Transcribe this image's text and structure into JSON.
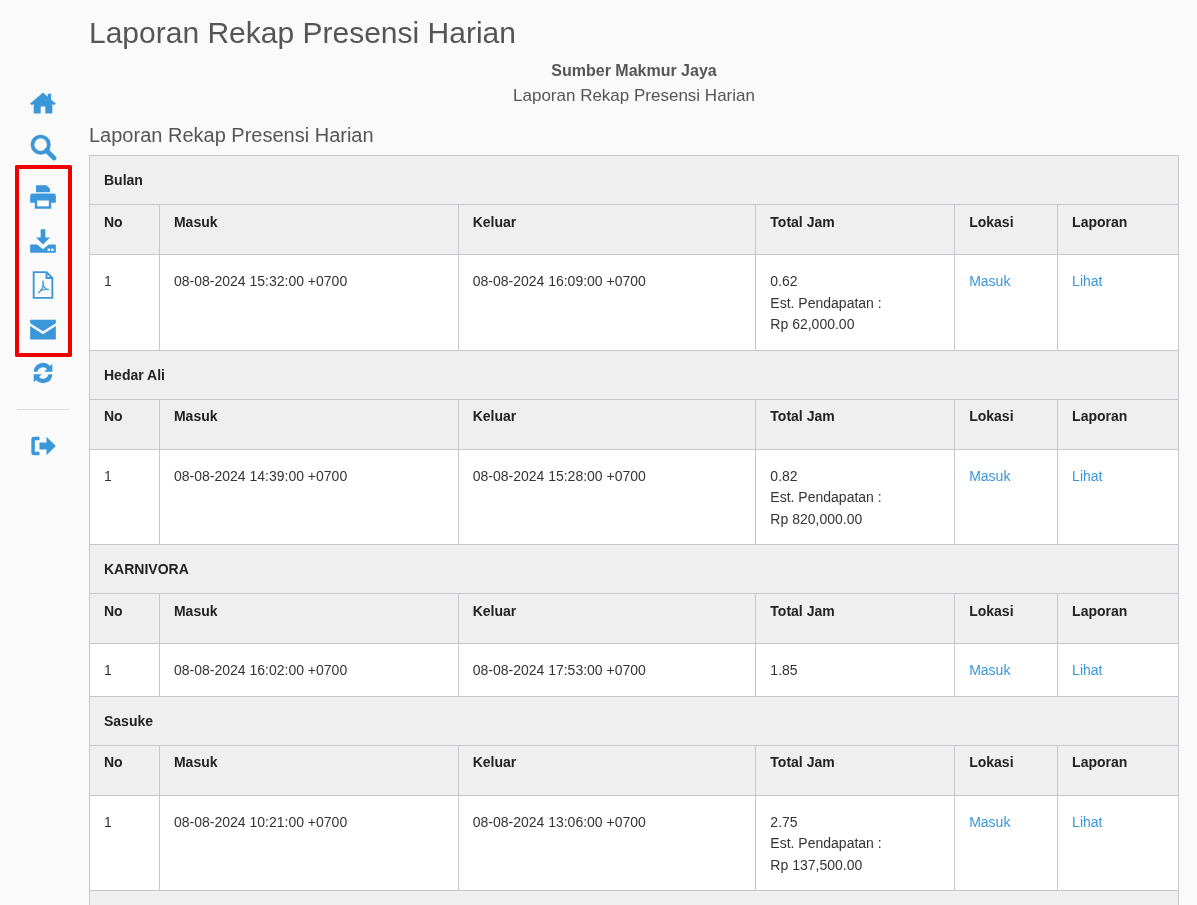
{
  "page_title": "Laporan Rekap Presensi Harian",
  "company": "Sumber Makmur Jaya",
  "subtitle": "Laporan Rekap Presensi Harian",
  "section_title": "Laporan Rekap Presensi Harian",
  "sidebar": {
    "items": [
      {
        "kind": "home",
        "highlighted": false
      },
      {
        "kind": "search",
        "highlighted": false
      },
      {
        "kind": "print",
        "highlighted": true
      },
      {
        "kind": "download",
        "highlighted": true
      },
      {
        "kind": "pdf",
        "highlighted": true
      },
      {
        "kind": "email",
        "highlighted": true
      },
      {
        "kind": "refresh",
        "highlighted": false
      },
      {
        "kind": "logout",
        "highlighted": false
      }
    ]
  },
  "groups": [
    {
      "name": "Bulan",
      "columns": [
        "No",
        "Masuk",
        "Keluar",
        "Total Jam",
        "Lokasi",
        "Laporan"
      ],
      "rows": [
        {
          "no": "1",
          "masuk": "08-08-2024 15:32:00 +0700",
          "keluar": "08-08-2024 16:09:00 +0700",
          "total_jam": [
            "0.62",
            "Est. Pendapatan :",
            "Rp 62,000.00"
          ],
          "lokasi": "Masuk",
          "laporan": "Lihat"
        }
      ]
    },
    {
      "name": "Hedar Ali",
      "columns": [
        "No",
        "Masuk",
        "Keluar",
        "Total Jam",
        "Lokasi",
        "Laporan"
      ],
      "rows": [
        {
          "no": "1",
          "masuk": "08-08-2024 14:39:00 +0700",
          "keluar": "08-08-2024 15:28:00 +0700",
          "total_jam": [
            "0.82",
            "Est. Pendapatan :",
            "Rp 820,000.00"
          ],
          "lokasi": "Masuk",
          "laporan": "Lihat"
        }
      ]
    },
    {
      "name": "KARNIVORA",
      "columns": [
        "No",
        "Masuk",
        "Keluar",
        "Total Jam",
        "Lokasi",
        "Laporan"
      ],
      "rows": [
        {
          "no": "1",
          "masuk": "08-08-2024 16:02:00 +0700",
          "keluar": "08-08-2024 17:53:00 +0700",
          "total_jam": [
            "1.85"
          ],
          "lokasi": "Masuk",
          "laporan": "Lihat"
        }
      ]
    },
    {
      "name": "Sasuke",
      "columns": [
        "No",
        "Masuk",
        "Keluar",
        "Total Jam",
        "Lokasi",
        "Laporan"
      ],
      "rows": [
        {
          "no": "1",
          "masuk": "08-08-2024 10:21:00 +0700",
          "keluar": "08-08-2024 13:06:00 +0700",
          "total_jam": [
            "2.75",
            "Est. Pendapatan :",
            "Rp 137,500.00"
          ],
          "lokasi": "Masuk",
          "laporan": "Lihat"
        }
      ]
    }
  ]
}
